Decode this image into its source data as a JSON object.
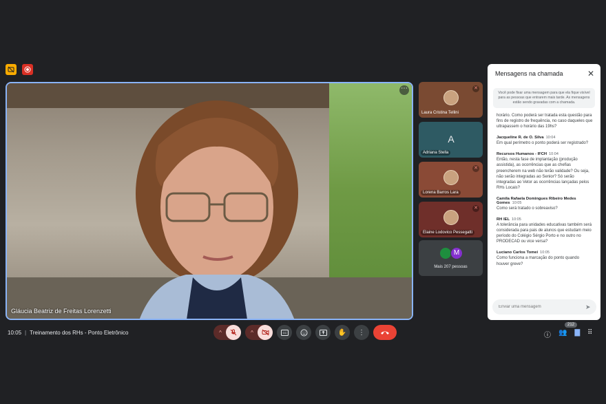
{
  "chat": {
    "title": "Mensagens na chamada",
    "pinned_note": "Você pode fixar uma mensagem para que ela fique visível para as pessoas que entrarem mais tarde. As mensagens estão sendo gravadas com a chamada.",
    "messages": [
      {
        "sender": "",
        "time": "",
        "text": "horário. Como poderá ser tratada esta questão para fins de registro de frequência, no caso daqueles que ultrapassem o horário das 19hs?"
      },
      {
        "sender": "Jacqueline R. de O. Silva",
        "time": "10:04",
        "text": "Em qual perímetro o ponto poderá ser registrado?"
      },
      {
        "sender": "Recursos Humanos - IFCH",
        "time": "10:04",
        "text": "Então, nesta fase de implantação (produção assistida), as ocorrências que as chefias preencherem na web não terão validade? Ou seja, não serão integradas ao Senior? Só serão integradas ao Vetor as ocorrências lançadas pelos RHs Locais?"
      },
      {
        "sender": "Camila Rafaela Domingues Ribeiro Medes Gomes",
        "time": "10:05",
        "text": "Como será tratado o sobreaviso?"
      },
      {
        "sender": "RH IEL",
        "time": "10:05",
        "text": "A tolerância para unidades educativas também será considerada para pais de alunos que estudam meio período do Colégio Sérgio Porto e no outro no PRODECAD ou vice versa?"
      },
      {
        "sender": "Luciano Carlos Tomei",
        "time": "10:05",
        "text": "Como funciona a marcação do ponto quando houver greve?"
      }
    ],
    "input_placeholder": "Enviar uma mensagem"
  },
  "main_tile": {
    "name": "Gláucia Beatriz de Freitas Lorenzetti"
  },
  "participants": [
    {
      "name": "Laura Cristina Tellini",
      "bg": "#7a4a32",
      "avatar": "photo"
    },
    {
      "name": "Adriana Stella",
      "bg": "#2e5a63",
      "avatar": "A"
    },
    {
      "name": "Lorena Barros Lara",
      "bg": "#8a4a36",
      "avatar": "photo"
    },
    {
      "name": "Elaine Lodovico Pessegatti",
      "bg": "#6f2f2a",
      "avatar": "photo"
    }
  ],
  "more_people": {
    "label": "Mais 207 pessoas",
    "avatar_letter": "M"
  },
  "meeting": {
    "time": "10:05",
    "title": "Treinamento dos RHs - Ponto Eletrônico"
  },
  "people_count": "212",
  "icons": {
    "captions": "captions-off-icon",
    "record": "recording-icon",
    "mic": "mic-off-icon",
    "camera": "camera-off-icon",
    "cc": "closed-captions-icon",
    "emoji": "emoji-icon",
    "present": "present-screen-icon",
    "hand": "raise-hand-icon",
    "more": "more-options-icon",
    "hangup": "hang-up-icon",
    "info": "info-icon",
    "people": "people-icon",
    "chat": "chat-icon",
    "activities": "activities-icon"
  },
  "colors": {
    "accent": "#8ab4f8",
    "hangup": "#ea4335",
    "muted_bg": "#f9dedc"
  }
}
